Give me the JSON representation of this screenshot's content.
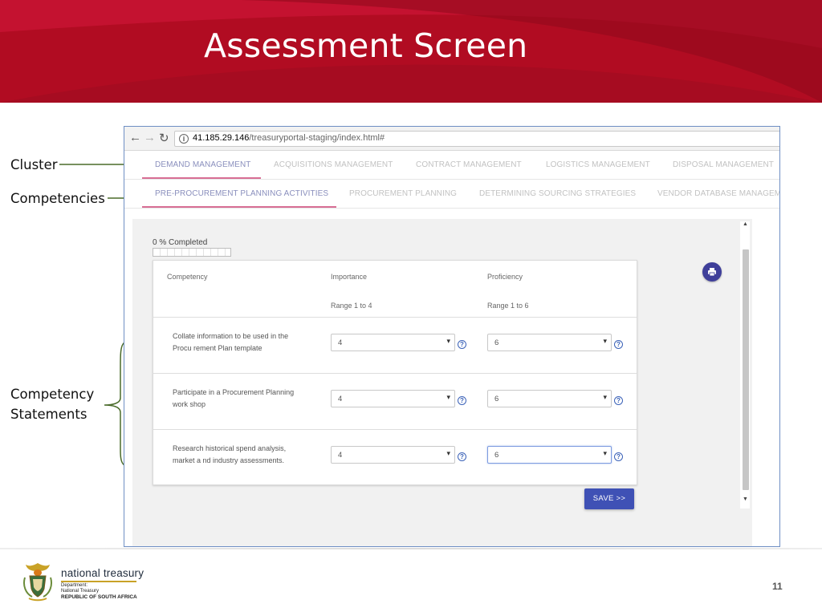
{
  "slide": {
    "title": "Assessment Screen",
    "page_number": "11"
  },
  "annotations": {
    "cluster": "Cluster",
    "competencies": "Competencies",
    "statements_line1": "Competency",
    "statements_line2": "Statements"
  },
  "browser": {
    "back_icon": "back-arrow-icon",
    "forward_icon": "forward-arrow-icon",
    "reload_icon": "reload-icon",
    "url_host": "41.185.29.146",
    "url_path": "/treasuryportal-staging/index.html#"
  },
  "cluster_tabs": [
    {
      "label": "DEMAND MANAGEMENT",
      "active": true
    },
    {
      "label": "ACQUISITIONS MANAGEMENT",
      "active": false
    },
    {
      "label": "CONTRACT MANAGEMENT",
      "active": false
    },
    {
      "label": "LOGISTICS MANAGEMENT",
      "active": false
    },
    {
      "label": "DISPOSAL MANAGEMENT",
      "active": false
    }
  ],
  "competency_tabs": [
    {
      "label": "PRE-PROCUREMENT PLANNING ACTIVITIES",
      "active": true
    },
    {
      "label": "PROCUREMENT PLANNING",
      "active": false
    },
    {
      "label": "DETERMINING SOURCING STRATEGIES",
      "active": false
    },
    {
      "label": "VENDOR DATABASE MANAGEME",
      "active": false
    }
  ],
  "progress": {
    "label": "0 % Completed",
    "percent": 0
  },
  "table": {
    "headers": {
      "competency": "Competency",
      "importance": "Importance",
      "importance_range": "Range 1 to 4",
      "proficiency": "Proficiency",
      "proficiency_range": "Range 1 to 6"
    },
    "rows": [
      {
        "statement": "Collate information to be used in the Procu rement Plan template",
        "importance": "4",
        "proficiency": "6"
      },
      {
        "statement": "Participate in a Procurement Planning work shop",
        "importance": "4",
        "proficiency": "6"
      },
      {
        "statement": "Research historical spend analysis, market a nd industry assessments.",
        "importance": "4",
        "proficiency": "6"
      }
    ]
  },
  "buttons": {
    "save": "SAVE >>",
    "print_icon": "print-icon"
  },
  "footer": {
    "brand": "national treasury",
    "dept1": "Department:",
    "dept2": "National Treasury",
    "dept3": "REPUBLIC OF SOUTH AFRICA"
  },
  "colors": {
    "header_red": "#b30d24",
    "active_tab": "#8a8fbd",
    "tab_underline": "#d86e94",
    "save_button": "#3f51b5",
    "annotation_arrow": "#4a6b2a"
  }
}
